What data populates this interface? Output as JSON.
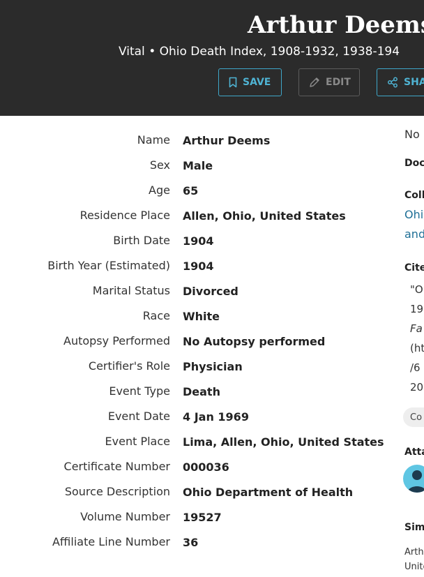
{
  "header": {
    "title": "Arthur Deems",
    "subtitle": "Vital • Ohio Death Index, 1908-1932, 1938-194",
    "buttons": {
      "save": "SAVE",
      "edit": "EDIT",
      "share": "SHA"
    }
  },
  "details": [
    {
      "label": "Name",
      "value": "Arthur Deems"
    },
    {
      "label": "Sex",
      "value": "Male"
    },
    {
      "label": "Age",
      "value": "65"
    },
    {
      "label": "Residence Place",
      "value": "Allen, Ohio, United States"
    },
    {
      "label": "Birth Date",
      "value": "1904"
    },
    {
      "label": "Birth Year (Estimated)",
      "value": "1904"
    },
    {
      "label": "Marital Status",
      "value": "Divorced"
    },
    {
      "label": "Race",
      "value": "White"
    },
    {
      "label": "Autopsy Performed",
      "value": "No Autopsy performed"
    },
    {
      "label": "Certifier's Role",
      "value": "Physician"
    },
    {
      "label": "Event Type",
      "value": "Death"
    },
    {
      "label": "Event Date",
      "value": "4 Jan 1969"
    },
    {
      "label": "Event Place",
      "value": "Lima, Allen, Ohio, United States"
    },
    {
      "label": "Certificate Number",
      "value": "000036"
    },
    {
      "label": "Source Description",
      "value": "Ohio Department of Health"
    },
    {
      "label": "Volume Number",
      "value": "19527"
    },
    {
      "label": "Affiliate Line Number",
      "value": "36"
    }
  ],
  "sidebar": {
    "no_text": "No",
    "doc_heading": "Doc",
    "coll_heading": "Coll",
    "coll_link_1": "Ohio",
    "coll_link_2": "and",
    "cite_heading": "Cite",
    "cite_lines": [
      "\"O",
      "19",
      "Fa",
      "(ht",
      "/6",
      "20"
    ],
    "chip": "Co",
    "attach_heading": "Atta",
    "similar_heading": "Sim",
    "similar_line_1": "Arth",
    "similar_line_2": "Unite"
  },
  "colors": {
    "header_bg": "#2b2b2b",
    "accent": "#3fa7c9",
    "link": "#1f6f96"
  }
}
